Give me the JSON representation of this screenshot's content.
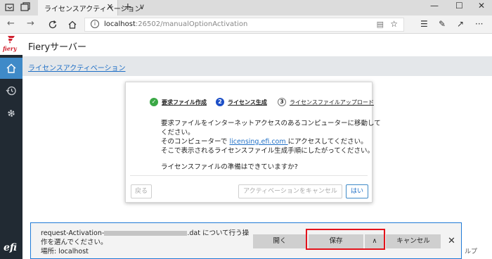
{
  "browser": {
    "tab_title": "ライセンスアクティベーション",
    "tab_close": "✕",
    "new_tab": "+",
    "tab_list": "∨",
    "url_host": "localhost",
    "url_path": ":26502/manualOptionActivation",
    "window_controls": [
      "—",
      "☐",
      "✕"
    ]
  },
  "app": {
    "brand_logo_text": "fiery",
    "title": "Fieryサーバー",
    "breadcrumb": "ライセンスアクティベーション",
    "footer_logo": "efi",
    "sidebar_icons": [
      "home-icon",
      "history-icon",
      "gear-icon"
    ],
    "accent_color": "#3f8ac8",
    "sidebar_color": "#212a33"
  },
  "dialog": {
    "steps": [
      {
        "number": "✓",
        "label": "要求ファイル作成",
        "state": "done"
      },
      {
        "number": "2",
        "label": "ライセンス生成",
        "state": "current"
      },
      {
        "number": "3",
        "label": "ライセンスファイルアップロード",
        "state": "pending"
      }
    ],
    "line1": "要求ファイルをインターネットアクセスのあるコンピューターに移動して",
    "line2": "ください。",
    "line3_before": "そのコンピューターで ",
    "line3_link": "licensing.efi.com ",
    "line3_after": "にアクセスしてください。",
    "line4": "そこで表示されるライセンスファイル生成手順にしたがってください。",
    "question": "ライセンスファイルの準備はできていますか?",
    "back_button": "戻る",
    "cancel_button": "アクティベーションをキャンセル",
    "yes_button": "はい"
  },
  "download": {
    "file_prefix": "request-Activation-",
    "file_suffix": ".dat について行う操",
    "line2": "作を選んでください。",
    "location": "場所: localhost",
    "open_button": "開く",
    "save_button": "保存",
    "save_menu": "∧",
    "cancel_button": "キャンセル",
    "close": "✕"
  },
  "help_partial": "ルプ"
}
